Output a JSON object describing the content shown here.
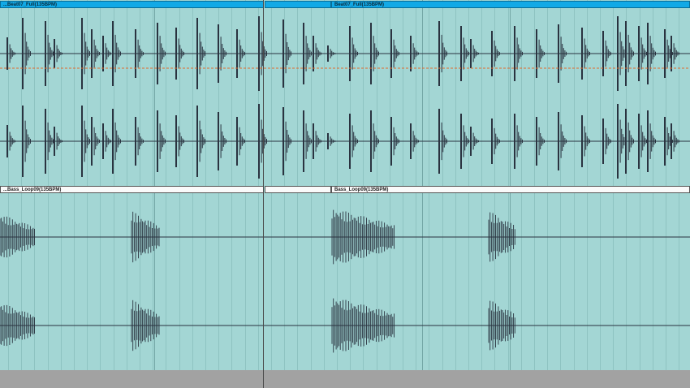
{
  "clips": [
    {
      "track": 1,
      "name": "...Beat07_Full(135BPM)"
    },
    {
      "track": 1,
      "name": "Beat07_Full(135BPM)"
    },
    {
      "track": 2,
      "name": "...Bass_Loop09(135BPM)"
    },
    {
      "track": 2,
      "name": "Bass_Loop09(135BPM)"
    }
  ],
  "colors": {
    "clip_body": "#a3d6d4",
    "beat_header": "#12a9e6",
    "bass_header": "#fafafa",
    "waveform": "#2a3340",
    "marker_line": "#e26a2c",
    "empty_lane": "#a2a2a2"
  }
}
